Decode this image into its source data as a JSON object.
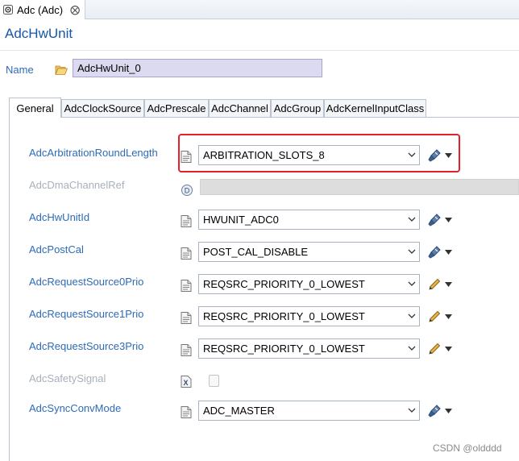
{
  "editor_tab": {
    "title": "Adc (Adc)",
    "close": "⨂"
  },
  "page": {
    "title": "AdcHwUnit"
  },
  "name_field": {
    "label": "Name",
    "value": "AdcHwUnit_0"
  },
  "tabs": [
    {
      "label": "General",
      "active": true
    },
    {
      "label": "AdcClockSource",
      "active": false
    },
    {
      "label": "AdcPrescale",
      "active": false
    },
    {
      "label": "AdcChannel",
      "active": false
    },
    {
      "label": "AdcGroup",
      "active": false
    },
    {
      "label": "AdcKernelInputClass",
      "active": false
    }
  ],
  "params": [
    {
      "label": "AdcArbitrationRoundLength",
      "value": "ARBITRATION_SLOTS_8",
      "action_icon": "calculate-icon",
      "highlighted": true
    },
    {
      "label": "AdcDmaChannelRef",
      "value": "",
      "disabled": true,
      "action_icon": "reference-icon"
    },
    {
      "label": "AdcHwUnitId",
      "value": "HWUNIT_ADC0",
      "action_icon": "calculate-icon"
    },
    {
      "label": "AdcPostCal",
      "value": "POST_CAL_DISABLE",
      "action_icon": "calculate-icon"
    },
    {
      "label": "AdcRequestSource0Prio",
      "value": "REQSRC_PRIORITY_0_LOWEST",
      "action_icon": "pencil-icon"
    },
    {
      "label": "AdcRequestSource1Prio",
      "value": "REQSRC_PRIORITY_0_LOWEST",
      "action_icon": "pencil-icon"
    },
    {
      "label": "AdcRequestSource3Prio",
      "value": "REQSRC_PRIORITY_0_LOWEST",
      "action_icon": "pencil-icon"
    },
    {
      "label": "AdcSafetySignal",
      "value": "",
      "disabled": true,
      "checkbox": true
    },
    {
      "label": "AdcSyncConvMode",
      "value": "ADC_MASTER",
      "action_icon": "calculate-icon"
    }
  ],
  "watermark": "CSDN @oldddd",
  "colors": {
    "label_blue": "#2d6bb7",
    "title_blue": "#1558a8",
    "highlight_red": "#e5202a",
    "name_field_bg": "#dcdaf0"
  }
}
